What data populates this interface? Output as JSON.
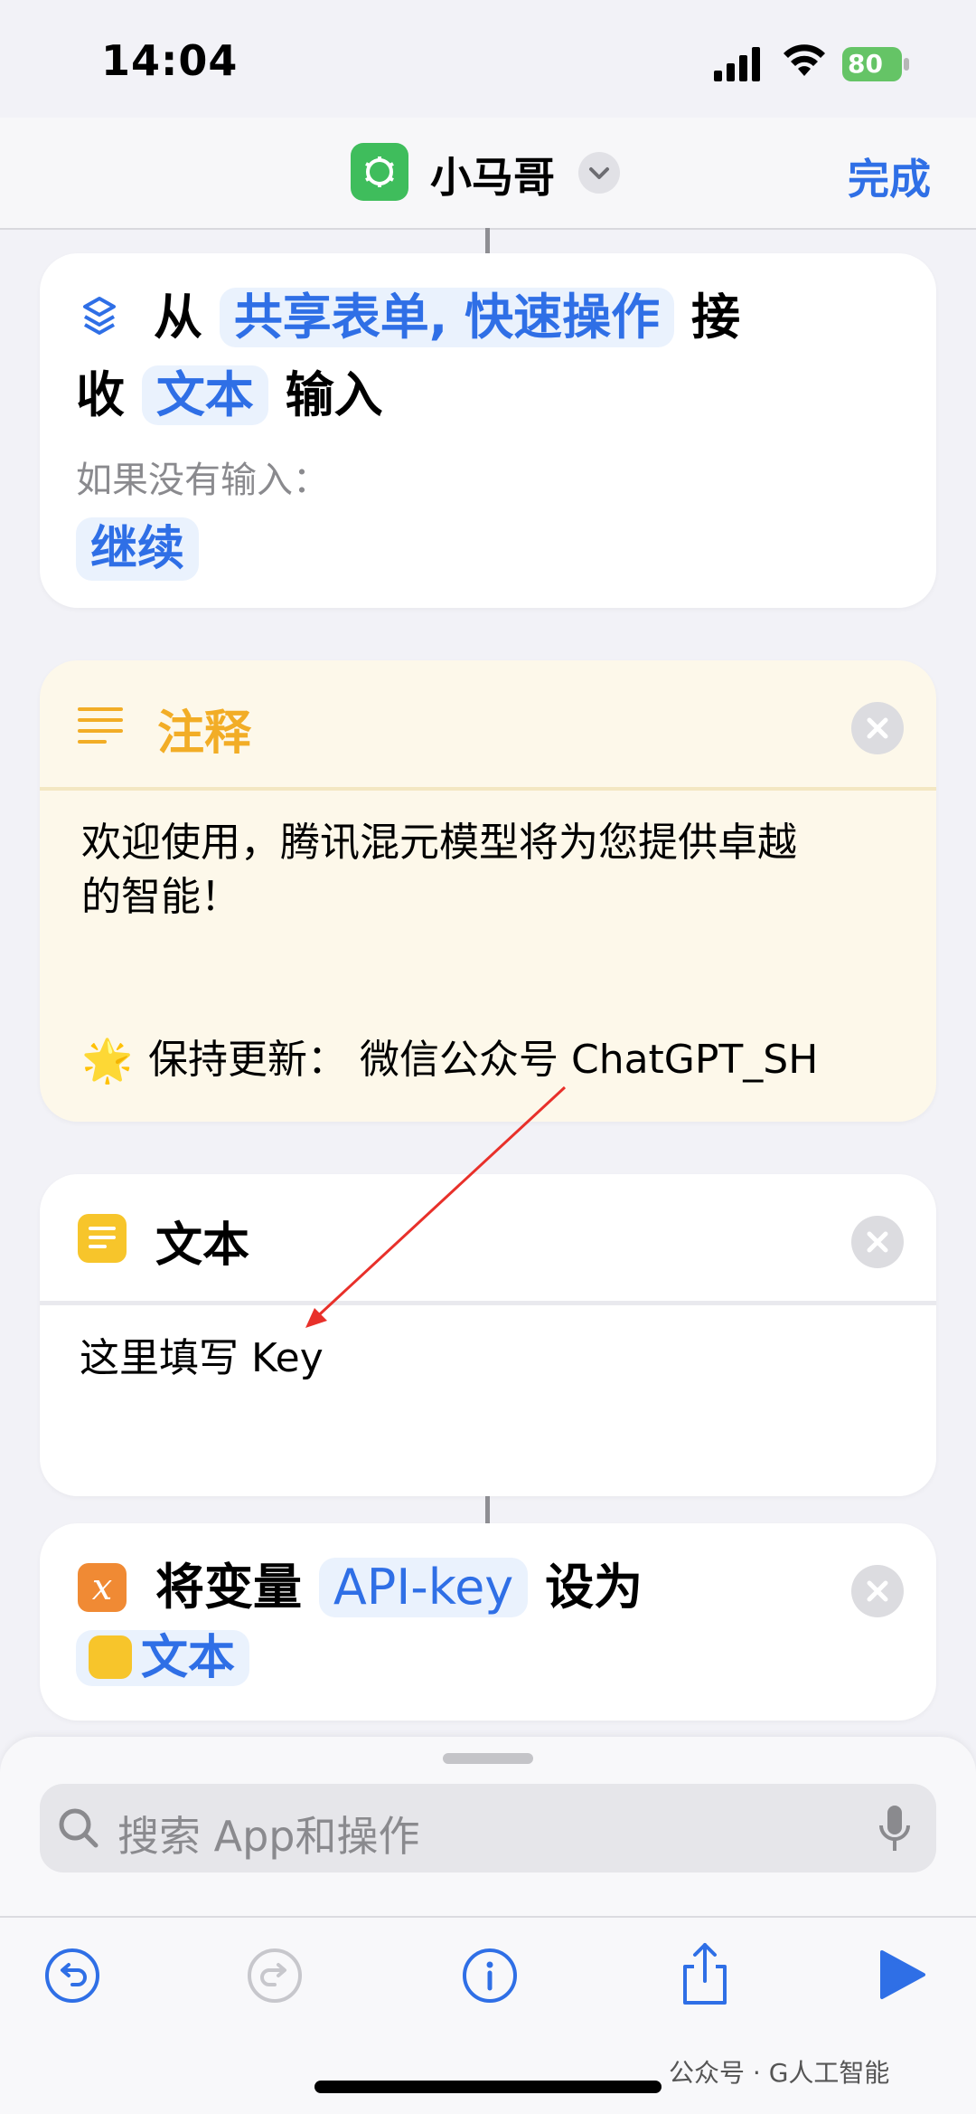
{
  "status": {
    "time": "14:04",
    "battery": "80"
  },
  "nav": {
    "title": "小马哥",
    "done_label": "完成",
    "app_icon": "openai-logo-icon"
  },
  "receive_card": {
    "prefix": "从",
    "sources_chip": "共享表单, 快速操作",
    "suffix1": "接",
    "prefix2": "收",
    "type_chip": "文本",
    "suffix2": "输入",
    "if_no_input_label": "如果没有输入：",
    "continue_chip": "继续"
  },
  "comment_card": {
    "title": "注释",
    "line1": "欢迎使用，腾讯混元模型将为您提供卓越",
    "line2": "的智能！",
    "star_emoji": "🌟",
    "update_text": "保持更新：  微信公众号 ChatGPT_SH"
  },
  "text_card": {
    "title": "文本",
    "content": "这里填写 Key"
  },
  "set_var_card": {
    "prefix": "将变量",
    "var_chip": "API-key",
    "suffix": "设为",
    "value_chip": "文本",
    "var_glyph": "x"
  },
  "search": {
    "placeholder": "搜索 App和操作"
  },
  "watermark": "公众号 · G人工智能",
  "colors": {
    "accent": "#2f6fe6",
    "comment": "#f2ad26",
    "variable": "#f08a34",
    "text_action": "#f7c52b"
  }
}
